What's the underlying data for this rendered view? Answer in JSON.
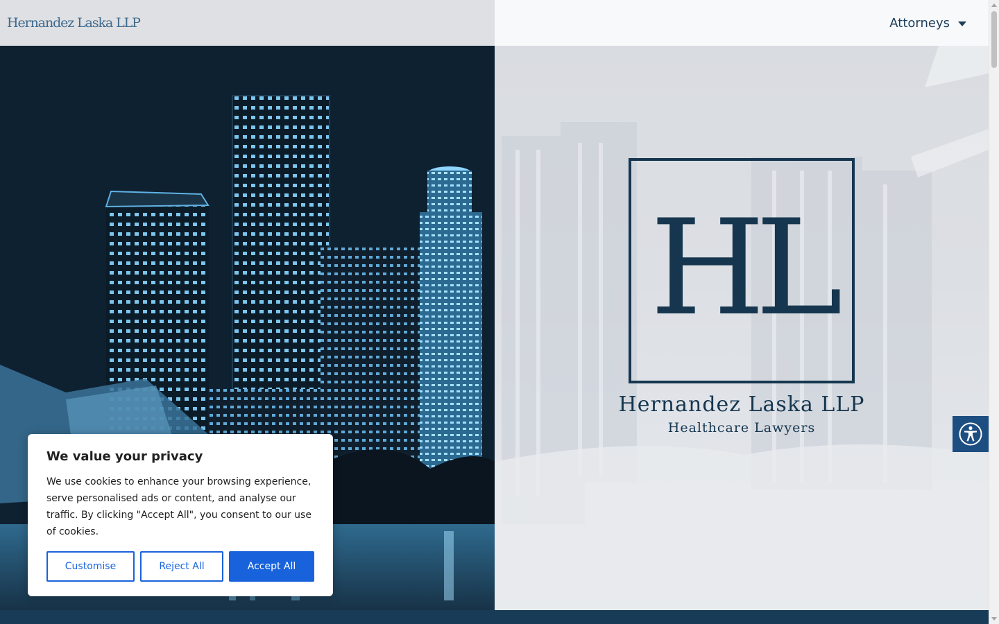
{
  "header": {
    "brand": "Hernandez Laska LLP",
    "nav": {
      "attorneys_label": "Attorneys"
    }
  },
  "hero": {
    "monogram": "HL",
    "firm_name": "Hernandez Laska LLP",
    "tagline": "Healthcare Lawyers"
  },
  "cookie_banner": {
    "title": "We value your privacy",
    "text": "We use cookies to enhance your browsing experience, serve personalised ads or content, and analyse our traffic. By clicking \"Accept All\", you consent to our use of cookies.",
    "buttons": {
      "customise": "Customise",
      "reject": "Reject All",
      "accept": "Accept All"
    }
  },
  "icons": {
    "accessibility": "accessibility-icon",
    "dropdown": "chevron-down-icon"
  },
  "colors": {
    "brand_navy": "#16364f",
    "cookie_accent": "#1863dc",
    "accessibility_button": "#1d4e82",
    "footer_band": "#183b57"
  }
}
